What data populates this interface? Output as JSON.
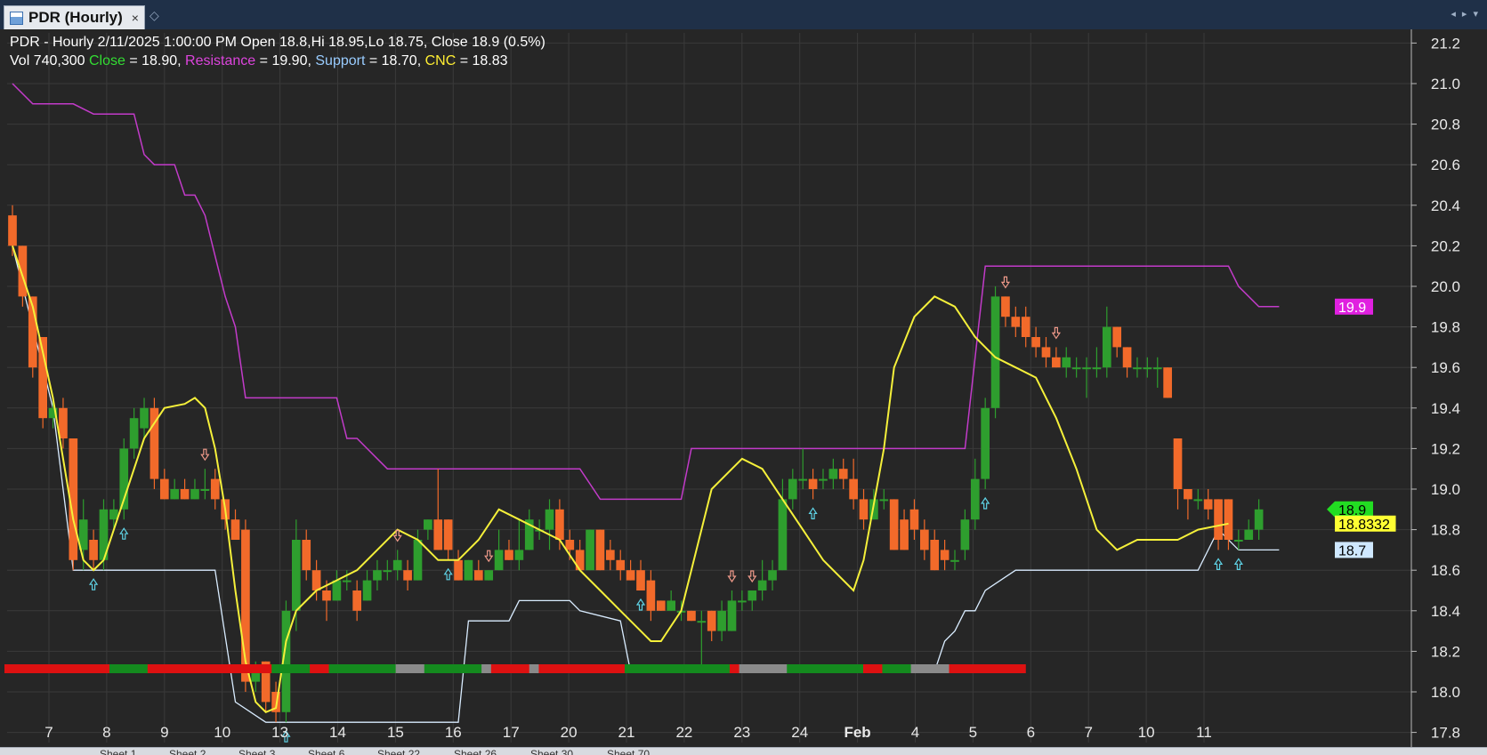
{
  "window": {
    "tab_title": "PDR (Hourly)",
    "close_glyph": "×",
    "pin_glyph": "◇",
    "nav_glyphs": "◂ ▸ ▾"
  },
  "info": {
    "line1": "PDR - Hourly 2/11/2025 1:00:00 PM Open 18.8,Hi 18.95,Lo 18.75, Close 18.9 (0.5%)",
    "vol_text": "Vol 740,300 ",
    "close_label": "Close",
    "close_value": " = 18.90, ",
    "resistance_label": "Resistance",
    "resistance_value": " = 19.90, ",
    "support_label": "Support",
    "support_value": " = 18.70, ",
    "cnc_label": "CNC",
    "cnc_value": " = 18.83"
  },
  "colors": {
    "background": "#262626",
    "grid": "#3a3a3a",
    "up": "#2e9e2e",
    "down": "#f26a2a",
    "resistance": "#c23bc9",
    "support": "#d9ecff",
    "cnc": "#f5f03a",
    "close_label": "#33dd33",
    "resistance_label": "#dd44dd",
    "support_label": "#99ccff",
    "cnc_label": "#ffee33",
    "buy_arrow": "#5fd3e6",
    "sell_arrow": "#f09a8a"
  },
  "badges": {
    "resistance": "19.9",
    "close": "18.9",
    "cnc": "18.8332",
    "support": "18.7"
  },
  "sheet_tabs": [
    "Sheet 1",
    "Sheet 2",
    "Sheet 3",
    "Sheet 6",
    "Sheet 22",
    "Sheet 26",
    "Sheet 30",
    "Sheet 70"
  ],
  "chart_data": {
    "type": "candlestick",
    "symbol": "PDR",
    "interval": "Hourly",
    "ylim": [
      17.75,
      21.25
    ],
    "y_ticks": [
      17.8,
      18.0,
      18.2,
      18.4,
      18.6,
      18.8,
      19.0,
      19.2,
      19.4,
      19.6,
      19.8,
      20.0,
      20.2,
      20.4,
      20.6,
      20.8,
      21.0,
      21.2
    ],
    "x_tick_labels": [
      "7",
      "8",
      "9",
      "10",
      "13",
      "14",
      "15",
      "16",
      "17",
      "20",
      "21",
      "22",
      "23",
      "24",
      "Feb",
      "4",
      "5",
      "6",
      "7",
      "10",
      "11"
    ],
    "candles": [
      [
        20.35,
        20.2,
        20.4,
        20.15
      ],
      [
        20.2,
        19.95,
        20.2,
        19.9
      ],
      [
        19.95,
        19.6,
        19.95,
        19.55
      ],
      [
        19.75,
        19.35,
        19.75,
        19.3
      ],
      [
        19.35,
        19.4,
        19.45,
        19.3
      ],
      [
        19.4,
        19.25,
        19.45,
        19.2
      ],
      [
        19.25,
        18.65,
        19.25,
        18.6
      ],
      [
        18.7,
        18.85,
        18.95,
        18.6
      ],
      [
        18.75,
        18.65,
        18.8,
        18.6
      ],
      [
        18.65,
        18.9,
        18.95,
        18.6
      ],
      [
        18.85,
        18.9,
        18.95,
        18.8
      ],
      [
        18.9,
        19.2,
        19.25,
        18.85
      ],
      [
        19.2,
        19.35,
        19.4,
        19.15
      ],
      [
        19.3,
        19.4,
        19.45,
        19.25
      ],
      [
        19.4,
        19.05,
        19.45,
        19.0
      ],
      [
        19.05,
        18.95,
        19.1,
        18.95
      ],
      [
        18.95,
        19.0,
        19.05,
        18.95
      ],
      [
        19.0,
        18.95,
        19.05,
        18.95
      ],
      [
        18.95,
        19.0,
        19.05,
        18.95
      ],
      [
        19.0,
        19.0,
        19.1,
        18.95
      ],
      [
        19.05,
        18.95,
        19.1,
        18.9
      ],
      [
        18.95,
        18.85,
        18.95,
        18.8
      ],
      [
        18.85,
        18.75,
        18.9,
        18.75
      ],
      [
        18.8,
        18.05,
        18.85,
        18.0
      ],
      [
        18.05,
        18.1,
        18.15,
        18.0
      ],
      [
        18.15,
        17.95,
        18.15,
        17.9
      ],
      [
        18.0,
        17.9,
        18.05,
        17.85
      ],
      [
        17.9,
        18.4,
        18.45,
        17.85
      ],
      [
        18.4,
        18.75,
        18.85,
        18.3
      ],
      [
        18.75,
        18.6,
        18.8,
        18.55
      ],
      [
        18.6,
        18.5,
        18.65,
        18.45
      ],
      [
        18.5,
        18.45,
        18.55,
        18.35
      ],
      [
        18.45,
        18.55,
        18.6,
        18.45
      ],
      [
        18.55,
        18.55,
        18.6,
        18.5
      ],
      [
        18.5,
        18.4,
        18.55,
        18.35
      ],
      [
        18.45,
        18.55,
        18.6,
        18.45
      ],
      [
        18.55,
        18.6,
        18.65,
        18.5
      ],
      [
        18.6,
        18.6,
        18.65,
        18.55
      ],
      [
        18.6,
        18.65,
        18.7,
        18.55
      ],
      [
        18.6,
        18.55,
        18.65,
        18.5
      ],
      [
        18.55,
        18.75,
        18.8,
        18.55
      ],
      [
        18.8,
        18.85,
        18.85,
        18.75
      ],
      [
        18.85,
        18.7,
        19.1,
        18.7
      ],
      [
        18.85,
        18.7,
        18.85,
        18.65
      ],
      [
        18.65,
        18.55,
        18.7,
        18.55
      ],
      [
        18.55,
        18.65,
        18.65,
        18.55
      ],
      [
        18.6,
        18.55,
        18.65,
        18.55
      ],
      [
        18.55,
        18.6,
        18.6,
        18.55
      ],
      [
        18.6,
        18.7,
        18.8,
        18.6
      ],
      [
        18.7,
        18.65,
        18.75,
        18.65
      ],
      [
        18.65,
        18.7,
        18.85,
        18.6
      ],
      [
        18.7,
        18.85,
        18.9,
        18.7
      ],
      [
        18.8,
        18.8,
        18.85,
        18.75
      ],
      [
        18.8,
        18.9,
        18.95,
        18.7
      ],
      [
        18.9,
        18.75,
        18.95,
        18.7
      ],
      [
        18.75,
        18.7,
        18.8,
        18.65
      ],
      [
        18.7,
        18.6,
        18.75,
        18.6
      ],
      [
        18.6,
        18.8,
        18.8,
        18.6
      ],
      [
        18.8,
        18.6,
        18.8,
        18.6
      ],
      [
        18.7,
        18.65,
        18.75,
        18.6
      ],
      [
        18.65,
        18.6,
        18.7,
        18.55
      ],
      [
        18.6,
        18.55,
        18.65,
        18.55
      ],
      [
        18.6,
        18.5,
        18.65,
        18.5
      ],
      [
        18.55,
        18.4,
        18.6,
        18.35
      ],
      [
        18.45,
        18.4,
        18.45,
        18.4
      ],
      [
        18.4,
        18.45,
        18.5,
        18.4
      ],
      [
        18.4,
        18.4,
        18.45,
        18.35
      ],
      [
        18.4,
        18.35,
        18.4,
        18.35
      ],
      [
        18.35,
        18.35,
        18.4,
        18.1
      ],
      [
        18.4,
        18.3,
        18.4,
        18.25
      ],
      [
        18.3,
        18.4,
        18.45,
        18.25
      ],
      [
        18.3,
        18.45,
        18.5,
        18.3
      ],
      [
        18.45,
        18.45,
        18.5,
        18.4
      ],
      [
        18.45,
        18.5,
        18.5,
        18.4
      ],
      [
        18.5,
        18.55,
        18.65,
        18.45
      ],
      [
        18.55,
        18.6,
        18.65,
        18.5
      ],
      [
        18.6,
        18.95,
        19.05,
        18.6
      ],
      [
        18.95,
        19.05,
        19.1,
        18.9
      ],
      [
        19.05,
        19.05,
        19.2,
        19.0
      ],
      [
        19.05,
        19.0,
        19.1,
        18.95
      ],
      [
        19.05,
        19.05,
        19.1,
        19.0
      ],
      [
        19.05,
        19.1,
        19.15,
        19.0
      ],
      [
        19.1,
        19.05,
        19.15,
        19.0
      ],
      [
        19.05,
        18.95,
        19.15,
        18.9
      ],
      [
        18.95,
        18.85,
        19.0,
        18.8
      ],
      [
        18.85,
        18.95,
        19.0,
        18.85
      ],
      [
        18.95,
        18.95,
        19.0,
        18.9
      ],
      [
        18.95,
        18.7,
        18.95,
        18.7
      ],
      [
        18.85,
        18.7,
        18.9,
        18.7
      ],
      [
        18.9,
        18.8,
        18.95,
        18.75
      ],
      [
        18.8,
        18.7,
        18.85,
        18.65
      ],
      [
        18.75,
        18.6,
        18.8,
        18.6
      ],
      [
        18.7,
        18.65,
        18.75,
        18.6
      ],
      [
        18.65,
        18.65,
        18.7,
        18.6
      ],
      [
        18.7,
        18.85,
        18.9,
        18.65
      ],
      [
        18.85,
        19.05,
        19.15,
        18.8
      ],
      [
        19.05,
        19.4,
        19.45,
        19.0
      ],
      [
        19.4,
        19.95,
        20.0,
        19.35
      ],
      [
        19.95,
        19.85,
        19.95,
        19.8
      ],
      [
        19.85,
        19.8,
        19.9,
        19.75
      ],
      [
        19.85,
        19.75,
        19.9,
        19.7
      ],
      [
        19.75,
        19.7,
        19.8,
        19.65
      ],
      [
        19.7,
        19.65,
        19.75,
        19.6
      ],
      [
        19.65,
        19.6,
        19.7,
        19.6
      ],
      [
        19.6,
        19.65,
        19.7,
        19.55
      ],
      [
        19.6,
        19.6,
        19.65,
        19.55
      ],
      [
        19.6,
        19.6,
        19.65,
        19.45
      ],
      [
        19.6,
        19.6,
        19.7,
        19.55
      ],
      [
        19.6,
        19.8,
        19.9,
        19.55
      ],
      [
        19.8,
        19.7,
        19.8,
        19.65
      ],
      [
        19.7,
        19.6,
        19.7,
        19.55
      ],
      [
        19.6,
        19.6,
        19.65,
        19.55
      ],
      [
        19.6,
        19.6,
        19.65,
        19.55
      ],
      [
        19.6,
        19.6,
        19.65,
        19.5
      ],
      [
        19.6,
        19.45,
        19.6,
        19.45
      ],
      [
        19.25,
        19.0,
        19.25,
        18.9
      ],
      [
        19.0,
        18.95,
        19.0,
        18.85
      ],
      [
        18.95,
        18.95,
        19.0,
        18.9
      ],
      [
        18.95,
        18.9,
        19.0,
        18.85
      ],
      [
        18.95,
        18.75,
        18.95,
        18.7
      ],
      [
        18.95,
        18.75,
        18.95,
        18.7
      ],
      [
        18.75,
        18.75,
        18.8,
        18.7
      ],
      [
        18.75,
        18.8,
        18.85,
        18.75
      ],
      [
        18.8,
        18.9,
        18.95,
        18.75
      ]
    ],
    "resistance": [
      [
        0,
        21.0
      ],
      [
        2,
        20.9
      ],
      [
        6,
        20.9
      ],
      [
        8,
        20.85
      ],
      [
        12,
        20.85
      ],
      [
        13,
        20.65
      ],
      [
        14,
        20.6
      ],
      [
        16,
        20.6
      ],
      [
        17,
        20.45
      ],
      [
        18,
        20.45
      ],
      [
        19,
        20.35
      ],
      [
        20,
        20.15
      ],
      [
        21,
        19.95
      ],
      [
        22,
        19.8
      ],
      [
        23,
        19.45
      ],
      [
        32,
        19.45
      ],
      [
        33,
        19.25
      ],
      [
        34,
        19.25
      ],
      [
        36,
        19.15
      ],
      [
        37,
        19.1
      ],
      [
        56,
        19.1
      ],
      [
        58,
        18.95
      ],
      [
        66,
        18.95
      ],
      [
        67,
        19.2
      ],
      [
        80,
        19.2
      ],
      [
        81,
        19.2
      ],
      [
        82,
        19.2
      ],
      [
        83,
        19.2
      ],
      [
        91,
        19.2
      ],
      [
        94,
        19.2
      ],
      [
        96,
        20.1
      ],
      [
        120,
        20.1
      ],
      [
        121,
        20.0
      ],
      [
        123,
        19.9
      ],
      [
        125,
        19.9
      ]
    ],
    "support": [
      [
        0,
        20.2
      ],
      [
        2,
        19.8
      ],
      [
        4,
        19.4
      ],
      [
        6,
        18.6
      ],
      [
        20,
        18.6
      ],
      [
        22,
        17.95
      ],
      [
        25,
        17.85
      ],
      [
        26,
        17.85
      ],
      [
        44,
        17.85
      ],
      [
        45,
        18.35
      ],
      [
        49,
        18.35
      ],
      [
        50,
        18.45
      ],
      [
        55,
        18.45
      ],
      [
        56,
        18.4
      ],
      [
        60,
        18.35
      ],
      [
        61,
        18.1
      ],
      [
        77,
        18.1
      ],
      [
        78,
        18.1
      ],
      [
        82,
        18.1
      ],
      [
        91,
        18.1
      ],
      [
        92,
        18.25
      ],
      [
        93,
        18.3
      ],
      [
        94,
        18.4
      ],
      [
        95,
        18.4
      ],
      [
        96,
        18.5
      ],
      [
        99,
        18.6
      ],
      [
        117,
        18.6
      ],
      [
        119,
        18.8
      ],
      [
        121,
        18.7
      ],
      [
        125,
        18.7
      ]
    ],
    "cnc": [
      [
        0,
        20.2
      ],
      [
        2,
        19.9
      ],
      [
        4,
        19.45
      ],
      [
        6,
        18.85
      ],
      [
        7,
        18.65
      ],
      [
        8,
        18.6
      ],
      [
        9,
        18.65
      ],
      [
        10,
        18.8
      ],
      [
        11,
        18.95
      ],
      [
        13,
        19.25
      ],
      [
        15,
        19.4
      ],
      [
        17,
        19.42
      ],
      [
        18,
        19.45
      ],
      [
        19,
        19.4
      ],
      [
        20,
        19.2
      ],
      [
        21,
        18.9
      ],
      [
        22,
        18.5
      ],
      [
        23,
        18.15
      ],
      [
        24,
        17.95
      ],
      [
        25,
        17.9
      ],
      [
        26,
        17.92
      ],
      [
        27,
        18.25
      ],
      [
        28,
        18.4
      ],
      [
        30,
        18.5
      ],
      [
        32,
        18.55
      ],
      [
        34,
        18.6
      ],
      [
        36,
        18.7
      ],
      [
        38,
        18.8
      ],
      [
        40,
        18.75
      ],
      [
        42,
        18.65
      ],
      [
        44,
        18.65
      ],
      [
        46,
        18.75
      ],
      [
        48,
        18.9
      ],
      [
        50,
        18.85
      ],
      [
        52,
        18.8
      ],
      [
        54,
        18.75
      ],
      [
        56,
        18.6
      ],
      [
        58,
        18.5
      ],
      [
        60,
        18.4
      ],
      [
        62,
        18.3
      ],
      [
        63,
        18.25
      ],
      [
        64,
        18.25
      ],
      [
        66,
        18.4
      ],
      [
        67,
        18.6
      ],
      [
        69,
        19.0
      ],
      [
        71,
        19.1
      ],
      [
        72,
        19.15
      ],
      [
        74,
        19.1
      ],
      [
        76,
        18.95
      ],
      [
        78,
        18.8
      ],
      [
        80,
        18.65
      ],
      [
        82,
        18.55
      ],
      [
        83,
        18.5
      ],
      [
        84,
        18.65
      ],
      [
        86,
        19.2
      ],
      [
        87,
        19.6
      ],
      [
        89,
        19.85
      ],
      [
        91,
        19.95
      ],
      [
        93,
        19.9
      ],
      [
        95,
        19.75
      ],
      [
        97,
        19.65
      ],
      [
        99,
        19.6
      ],
      [
        101,
        19.55
      ],
      [
        103,
        19.35
      ],
      [
        105,
        19.1
      ],
      [
        107,
        18.8
      ],
      [
        109,
        18.7
      ],
      [
        111,
        18.75
      ],
      [
        113,
        18.75
      ],
      [
        115,
        18.75
      ],
      [
        117,
        18.8
      ],
      [
        120,
        18.83
      ]
    ],
    "buy_signal_indices": [
      8,
      11,
      27,
      43,
      62,
      79,
      96,
      119,
      121
    ],
    "sell_signal_indices": [
      19,
      38,
      47,
      71,
      73,
      98,
      103
    ],
    "state_bar": [
      [
        "r",
        11
      ],
      [
        "g",
        4
      ],
      [
        "r",
        13
      ],
      [
        "g",
        4
      ],
      [
        "r",
        2
      ],
      [
        "g",
        7
      ],
      [
        "x",
        3
      ],
      [
        "g",
        6
      ],
      [
        "x",
        1
      ],
      [
        "r",
        4
      ],
      [
        "x",
        1
      ],
      [
        "r",
        9
      ],
      [
        "g",
        11
      ],
      [
        "r",
        1
      ],
      [
        "x",
        5
      ],
      [
        "g",
        8
      ],
      [
        "r",
        2
      ],
      [
        "g",
        3
      ],
      [
        "x",
        4
      ],
      [
        "r",
        8
      ]
    ]
  }
}
